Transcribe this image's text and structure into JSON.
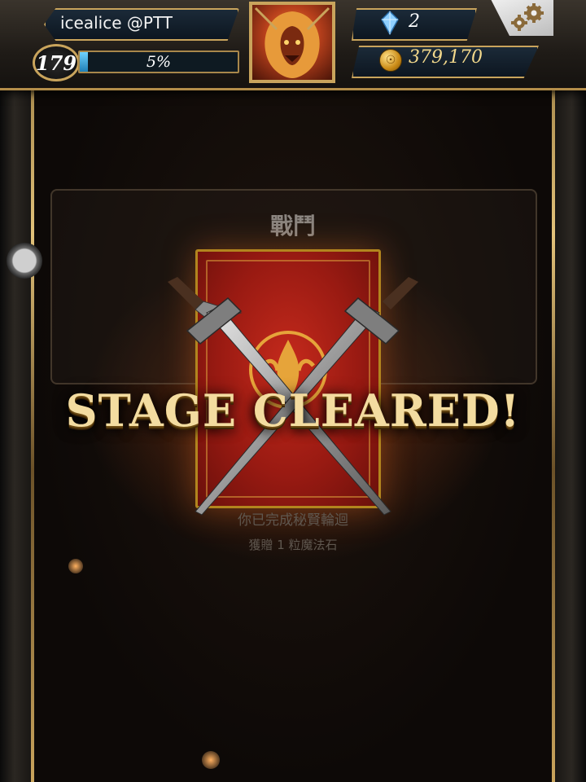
{
  "player": {
    "name": "icealice @PTT",
    "level": "179",
    "xp_percent_text": "5%",
    "xp_fraction": 0.05
  },
  "currency": {
    "gems": "2",
    "gold": "379,170"
  },
  "panel": {
    "title": "戰鬥"
  },
  "result": {
    "banner": "STAGE CLEARED!",
    "message": "你已完成秘賢輪迴",
    "reward": "獲贈 1 粒魔法石"
  },
  "icons": {
    "settings": "gear-icon",
    "gem": "gem-icon",
    "coin": "coin-icon",
    "swords": "crossed-swords-icon"
  },
  "colors": {
    "gold_trim": "#c9a45c",
    "card_red": "#c52a1c",
    "banner_text": "#f3dca0",
    "xp_fill": "#6fd3ff"
  }
}
